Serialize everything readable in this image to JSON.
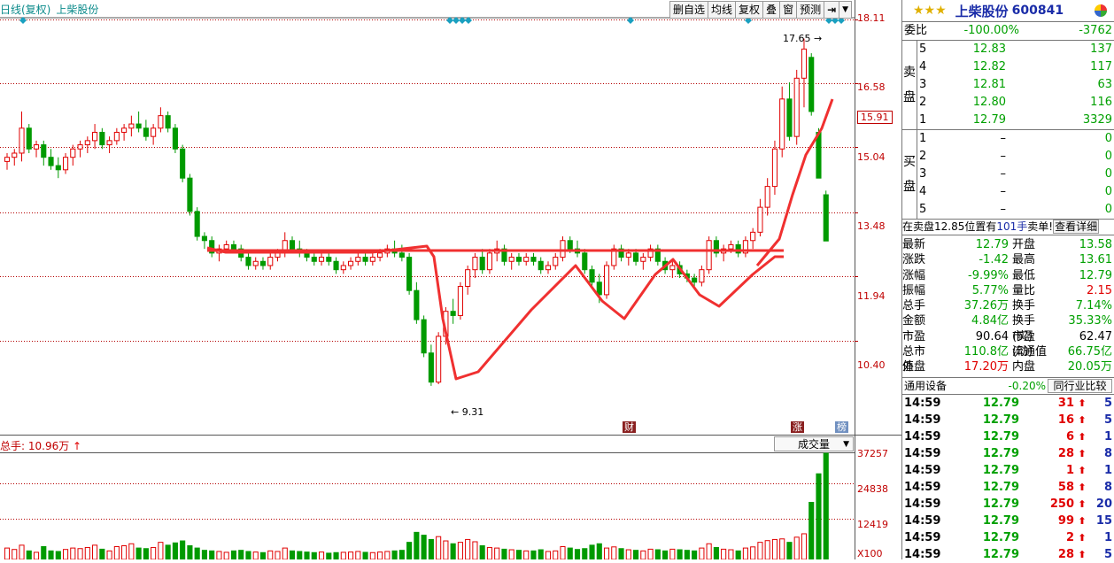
{
  "chart": {
    "period_label": "日线(复权)",
    "stock_name": "上柴股份",
    "toolbar": [
      "删自选",
      "均线",
      "复权",
      "叠",
      "窗",
      "预测"
    ],
    "price_ticks": [
      "18.11",
      "16.58",
      "15.91",
      "15.04",
      "13.48",
      "11.94",
      "10.40"
    ],
    "high_marker": "17.65",
    "low_marker": "9.31",
    "event_labels": [
      "财",
      "涨",
      "榜"
    ],
    "volume_title": "总手: 10.96万",
    "volume_select": "成交量",
    "volume_ticks": [
      "37257",
      "24838",
      "12419",
      "X100"
    ],
    "colors": {
      "up": "#e00000",
      "down": "#009a00",
      "pattern": "#f03030",
      "grid": "#b40000"
    }
  },
  "chart_data": {
    "type": "candlestick",
    "ylim": [
      8.5,
      18.11
    ],
    "annotations": {
      "max": 17.65,
      "min": 9.31
    },
    "candles": [
      [
        14.7,
        14.9,
        14.5,
        14.8
      ],
      [
        14.8,
        15.0,
        14.6,
        14.9
      ],
      [
        14.9,
        15.9,
        14.7,
        15.5
      ],
      [
        15.5,
        15.6,
        14.9,
        15.0
      ],
      [
        15.0,
        15.2,
        14.8,
        15.1
      ],
      [
        15.1,
        15.2,
        14.6,
        14.8
      ],
      [
        14.8,
        15.0,
        14.5,
        14.6
      ],
      [
        14.6,
        14.8,
        14.3,
        14.5
      ],
      [
        14.5,
        14.9,
        14.4,
        14.8
      ],
      [
        14.8,
        15.1,
        14.6,
        15.0
      ],
      [
        15.0,
        15.2,
        14.8,
        15.1
      ],
      [
        15.1,
        15.3,
        14.9,
        15.2
      ],
      [
        15.2,
        15.6,
        15.0,
        15.4
      ],
      [
        15.4,
        15.5,
        15.0,
        15.1
      ],
      [
        15.1,
        15.3,
        14.9,
        15.2
      ],
      [
        15.2,
        15.5,
        15.1,
        15.4
      ],
      [
        15.4,
        15.6,
        15.2,
        15.5
      ],
      [
        15.5,
        15.8,
        15.3,
        15.6
      ],
      [
        15.6,
        15.9,
        15.4,
        15.5
      ],
      [
        15.5,
        15.7,
        15.2,
        15.3
      ],
      [
        15.3,
        15.6,
        15.1,
        15.5
      ],
      [
        15.5,
        16.0,
        15.4,
        15.8
      ],
      [
        15.8,
        15.9,
        15.4,
        15.5
      ],
      [
        15.5,
        15.6,
        14.9,
        15.0
      ],
      [
        15.0,
        15.1,
        14.2,
        14.3
      ],
      [
        14.3,
        14.4,
        13.4,
        13.5
      ],
      [
        13.5,
        13.6,
        12.8,
        12.9
      ],
      [
        12.9,
        13.0,
        12.6,
        12.8
      ],
      [
        12.8,
        12.9,
        12.4,
        12.5
      ],
      [
        12.5,
        12.7,
        12.3,
        12.6
      ],
      [
        12.6,
        12.8,
        12.5,
        12.7
      ],
      [
        12.7,
        12.8,
        12.5,
        12.6
      ],
      [
        12.6,
        12.7,
        12.3,
        12.4
      ],
      [
        12.4,
        12.5,
        12.1,
        12.2
      ],
      [
        12.2,
        12.4,
        12.1,
        12.3
      ],
      [
        12.3,
        12.4,
        12.1,
        12.2
      ],
      [
        12.2,
        12.5,
        12.1,
        12.4
      ],
      [
        12.4,
        12.6,
        12.3,
        12.5
      ],
      [
        12.5,
        13.0,
        12.4,
        12.8
      ],
      [
        12.8,
        12.9,
        12.5,
        12.6
      ],
      [
        12.6,
        12.8,
        12.4,
        12.5
      ],
      [
        12.5,
        12.6,
        12.3,
        12.4
      ],
      [
        12.4,
        12.5,
        12.2,
        12.3
      ],
      [
        12.3,
        12.5,
        12.2,
        12.4
      ],
      [
        12.4,
        12.5,
        12.2,
        12.3
      ],
      [
        12.3,
        12.4,
        12.0,
        12.1
      ],
      [
        12.1,
        12.3,
        12.0,
        12.2
      ],
      [
        12.2,
        12.4,
        12.1,
        12.3
      ],
      [
        12.3,
        12.5,
        12.2,
        12.4
      ],
      [
        12.4,
        12.5,
        12.2,
        12.3
      ],
      [
        12.3,
        12.5,
        12.2,
        12.4
      ],
      [
        12.4,
        12.6,
        12.3,
        12.5
      ],
      [
        12.5,
        12.7,
        12.4,
        12.6
      ],
      [
        12.6,
        12.8,
        12.4,
        12.5
      ],
      [
        12.5,
        12.7,
        12.3,
        12.4
      ],
      [
        12.4,
        12.5,
        11.5,
        11.6
      ],
      [
        11.6,
        11.8,
        10.8,
        10.9
      ],
      [
        10.9,
        11.0,
        10.0,
        10.1
      ],
      [
        10.1,
        10.3,
        9.31,
        9.4
      ],
      [
        9.4,
        10.6,
        9.35,
        10.5
      ],
      [
        10.5,
        11.2,
        10.3,
        11.1
      ],
      [
        11.1,
        11.4,
        10.8,
        11.0
      ],
      [
        11.0,
        11.8,
        10.9,
        11.7
      ],
      [
        11.7,
        12.2,
        11.5,
        12.1
      ],
      [
        12.1,
        12.5,
        11.9,
        12.4
      ],
      [
        12.4,
        12.6,
        12.0,
        12.1
      ],
      [
        12.1,
        12.6,
        12.0,
        12.5
      ],
      [
        12.5,
        12.8,
        12.3,
        12.6
      ],
      [
        12.6,
        12.7,
        12.2,
        12.3
      ],
      [
        12.3,
        12.5,
        12.1,
        12.4
      ],
      [
        12.4,
        12.5,
        12.2,
        12.3
      ],
      [
        12.3,
        12.5,
        12.2,
        12.4
      ],
      [
        12.4,
        12.5,
        12.2,
        12.3
      ],
      [
        12.3,
        12.4,
        12.0,
        12.1
      ],
      [
        12.1,
        12.3,
        12.0,
        12.2
      ],
      [
        12.2,
        12.5,
        12.1,
        12.4
      ],
      [
        12.4,
        12.9,
        12.3,
        12.8
      ],
      [
        12.8,
        12.9,
        12.5,
        12.6
      ],
      [
        12.6,
        12.8,
        12.4,
        12.5
      ],
      [
        12.5,
        12.6,
        12.0,
        12.1
      ],
      [
        12.1,
        12.2,
        11.7,
        11.8
      ],
      [
        11.8,
        12.0,
        11.3,
        11.5
      ],
      [
        11.5,
        12.3,
        11.4,
        12.2
      ],
      [
        12.2,
        12.7,
        12.1,
        12.6
      ],
      [
        12.6,
        12.7,
        12.3,
        12.4
      ],
      [
        12.4,
        12.6,
        12.2,
        12.5
      ],
      [
        12.5,
        12.6,
        12.2,
        12.3
      ],
      [
        12.3,
        12.5,
        12.1,
        12.4
      ],
      [
        12.4,
        12.7,
        12.3,
        12.6
      ],
      [
        12.6,
        12.7,
        12.2,
        12.3
      ],
      [
        12.3,
        12.4,
        12.0,
        12.1
      ],
      [
        12.1,
        12.3,
        11.9,
        12.2
      ],
      [
        12.2,
        12.3,
        11.9,
        12.0
      ],
      [
        12.0,
        12.1,
        11.8,
        11.9
      ],
      [
        11.9,
        12.0,
        11.7,
        11.8
      ],
      [
        11.8,
        12.2,
        11.7,
        12.1
      ],
      [
        12.1,
        12.9,
        12.0,
        12.8
      ],
      [
        12.8,
        12.9,
        12.4,
        12.5
      ],
      [
        12.5,
        12.7,
        12.3,
        12.6
      ],
      [
        12.6,
        12.8,
        12.5,
        12.7
      ],
      [
        12.7,
        12.8,
        12.4,
        12.5
      ],
      [
        12.5,
        12.9,
        12.4,
        12.8
      ],
      [
        12.8,
        13.1,
        12.6,
        13.0
      ],
      [
        13.0,
        13.8,
        12.9,
        13.6
      ],
      [
        13.6,
        14.3,
        13.4,
        14.1
      ],
      [
        14.1,
        15.2,
        13.9,
        15.0
      ],
      [
        15.0,
        16.5,
        14.8,
        16.2
      ],
      [
        16.2,
        16.6,
        15.2,
        15.3
      ],
      [
        15.3,
        16.9,
        15.1,
        16.7
      ],
      [
        16.7,
        17.65,
        16.0,
        17.4
      ],
      [
        17.2,
        17.3,
        15.8,
        15.9
      ],
      [
        15.4,
        15.5,
        14.3,
        14.3
      ],
      [
        13.9,
        14.0,
        12.79,
        12.79
      ]
    ],
    "volumes": [
      40,
      35,
      50,
      30,
      25,
      45,
      30,
      28,
      35,
      40,
      38,
      42,
      50,
      36,
      30,
      45,
      48,
      55,
      40,
      38,
      42,
      60,
      50,
      58,
      65,
      48,
      40,
      32,
      30,
      28,
      25,
      30,
      32,
      28,
      26,
      24,
      30,
      28,
      40,
      30,
      28,
      26,
      24,
      26,
      22,
      24,
      25,
      26,
      28,
      25,
      24,
      26,
      28,
      30,
      32,
      60,
      95,
      85,
      70,
      80,
      65,
      55,
      60,
      70,
      62,
      48,
      42,
      40,
      36,
      34,
      32,
      30,
      30,
      34,
      28,
      30,
      45,
      40,
      35,
      38,
      50,
      55,
      40,
      44,
      38,
      34,
      32,
      30,
      36,
      34,
      30,
      36,
      34,
      32,
      30,
      40,
      55,
      42,
      36,
      34,
      30,
      40,
      44,
      60,
      66,
      70,
      72,
      60,
      78,
      90,
      200,
      300,
      372
    ]
  },
  "panel": {
    "stars": "★★★",
    "stock_name": "上柴股份",
    "stock_code": "600841",
    "weibi": {
      "label": "委比",
      "pct": "-100.00%",
      "value": "-3762"
    },
    "sell_label": [
      "卖",
      "盘"
    ],
    "buy_label": [
      "买",
      "盘"
    ],
    "sell": [
      {
        "lv": "5",
        "price": "12.83",
        "vol": "137"
      },
      {
        "lv": "4",
        "price": "12.82",
        "vol": "117"
      },
      {
        "lv": "3",
        "price": "12.81",
        "vol": "63"
      },
      {
        "lv": "2",
        "price": "12.80",
        "vol": "116"
      },
      {
        "lv": "1",
        "price": "12.79",
        "vol": "3329"
      }
    ],
    "buy": [
      {
        "lv": "1",
        "price": "–",
        "vol": "0"
      },
      {
        "lv": "2",
        "price": "–",
        "vol": "0"
      },
      {
        "lv": "3",
        "price": "–",
        "vol": "0"
      },
      {
        "lv": "4",
        "price": "–",
        "vol": "0"
      },
      {
        "lv": "5",
        "price": "–",
        "vol": "0"
      }
    ],
    "position": {
      "prefix": "在卖盘12.85位置有",
      "count": "101手",
      "single": "卖单!",
      "detail": "查看详细"
    },
    "quote": [
      {
        "l1": "最新",
        "v1": "12.79",
        "c1": "green",
        "l2": "开盘",
        "v2": "13.58",
        "c2": "green"
      },
      {
        "l1": "涨跌",
        "v1": "-1.42",
        "c1": "green",
        "l2": "最高",
        "v2": "13.61",
        "c2": "green"
      },
      {
        "l1": "涨幅",
        "v1": "-9.99%",
        "c1": "green",
        "l2": "最低",
        "v2": "12.79",
        "c2": "green"
      },
      {
        "l1": "振幅",
        "v1": "5.77%",
        "c1": "green",
        "l2": "量比",
        "v2": "2.15",
        "c2": "red"
      },
      {
        "l1": "总手",
        "v1": "37.26万",
        "c1": "green",
        "l2": "换手",
        "v2": "7.14%",
        "c2": "green"
      },
      {
        "l1": "金额",
        "v1": "4.84亿",
        "c1": "green",
        "l2": "换手(实)",
        "v2": "35.33%",
        "c2": "green"
      },
      {
        "l1": "市盈",
        "v1": "90.64",
        "c1": "black",
        "l2": "市盈(动)",
        "v2": "62.47",
        "c2": "black"
      },
      {
        "l1": "总市值",
        "v1": "110.8亿",
        "c1": "green",
        "l2": "流通值",
        "v2": "66.75亿",
        "c2": "green"
      },
      {
        "l1": "外盘",
        "v1": "17.20万",
        "c1": "red",
        "l2": "内盘",
        "v2": "20.05万",
        "c2": "green"
      }
    ],
    "industry": {
      "name": "通用设备",
      "change": "-0.20%",
      "button": "同行业比较"
    },
    "ticks": [
      {
        "t": "14:59",
        "p": "12.79",
        "v": "31",
        "n": "5"
      },
      {
        "t": "14:59",
        "p": "12.79",
        "v": "16",
        "n": "5"
      },
      {
        "t": "14:59",
        "p": "12.79",
        "v": "6",
        "n": "1"
      },
      {
        "t": "14:59",
        "p": "12.79",
        "v": "28",
        "n": "8"
      },
      {
        "t": "14:59",
        "p": "12.79",
        "v": "1",
        "n": "1"
      },
      {
        "t": "14:59",
        "p": "12.79",
        "v": "58",
        "n": "8"
      },
      {
        "t": "14:59",
        "p": "12.79",
        "v": "250",
        "n": "20"
      },
      {
        "t": "14:59",
        "p": "12.79",
        "v": "99",
        "n": "15"
      },
      {
        "t": "14:59",
        "p": "12.79",
        "v": "2",
        "n": "1"
      },
      {
        "t": "14:59",
        "p": "12.79",
        "v": "28",
        "n": "5"
      }
    ]
  }
}
